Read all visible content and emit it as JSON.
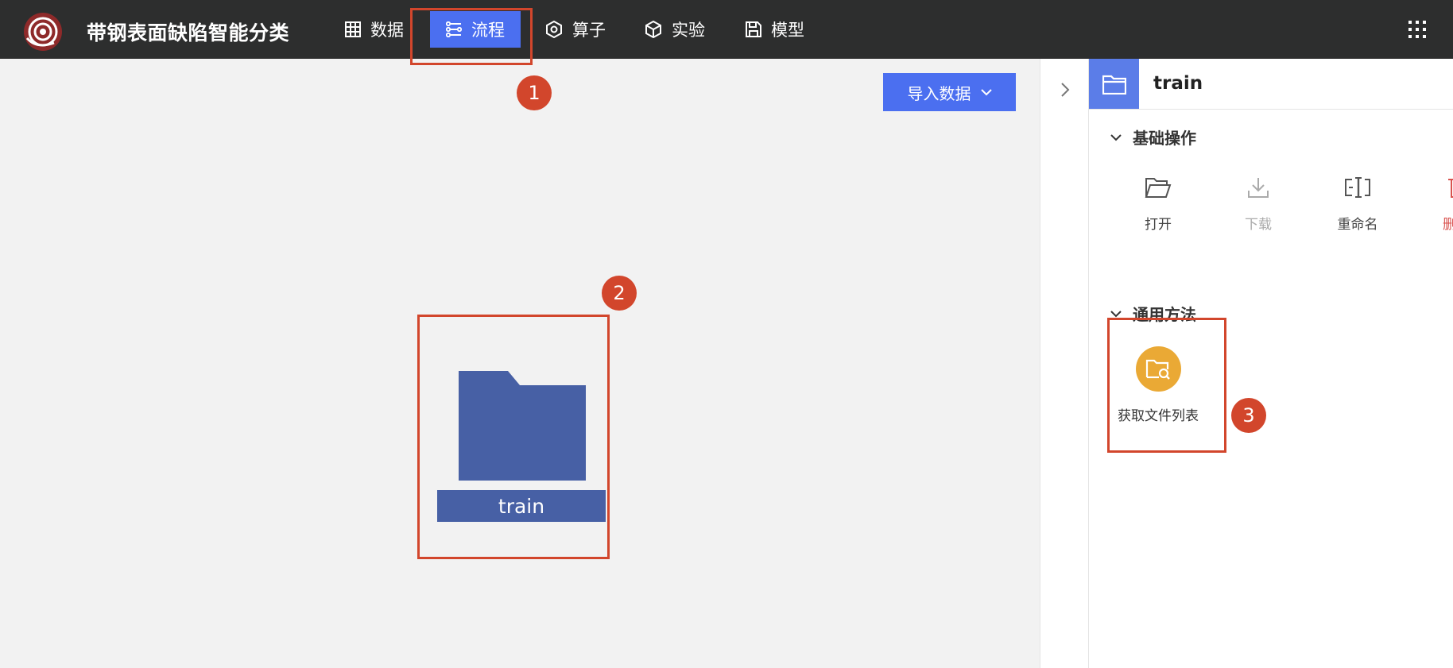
{
  "app": {
    "title": "带钢表面缺陷智能分类"
  },
  "nav": {
    "items": [
      {
        "label": "数据",
        "icon": "table-icon"
      },
      {
        "label": "流程",
        "icon": "flow-icon",
        "active": true
      },
      {
        "label": "算子",
        "icon": "hexagon-icon"
      },
      {
        "label": "实验",
        "icon": "cube-icon"
      },
      {
        "label": "模型",
        "icon": "save-icon"
      }
    ]
  },
  "canvas": {
    "import_button": {
      "label": "导入数据"
    },
    "node": {
      "label": "train",
      "icon": "folder-icon"
    }
  },
  "panel": {
    "title": "train",
    "sections": {
      "basic": {
        "title": "基础操作",
        "actions": [
          {
            "label": "打开",
            "icon": "folder-open-icon"
          },
          {
            "label": "下载",
            "icon": "download-icon",
            "disabled": true
          },
          {
            "label": "重命名",
            "icon": "rename-icon"
          },
          {
            "label": "删",
            "icon": "delete-icon"
          }
        ]
      },
      "general": {
        "title": "通用方法",
        "methods": [
          {
            "label": "获取文件列表",
            "icon": "folder-search-icon"
          }
        ]
      }
    }
  },
  "annotations": [
    {
      "label": "1"
    },
    {
      "label": "2"
    },
    {
      "label": "3"
    }
  ],
  "colors": {
    "topbar": "#2d2e2e",
    "accent": "#4b6ff0",
    "node": "#4760a5",
    "annotation": "#d2462c",
    "method_icon": "#eaa935"
  }
}
